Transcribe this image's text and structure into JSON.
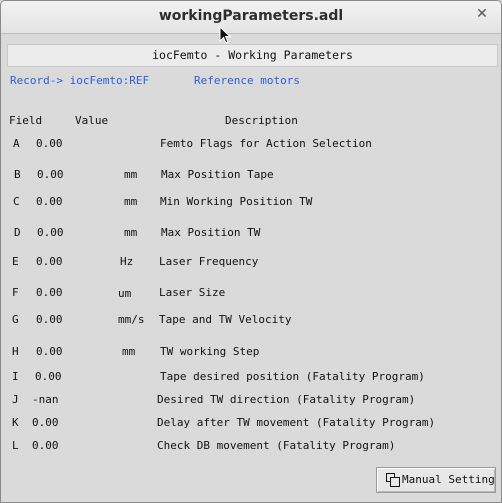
{
  "window": {
    "title": "workingParameters.adl",
    "close_glyph": "✕"
  },
  "banner": "iocFemto - Working Parameters",
  "record_link": "Record-> iocFemto:REF",
  "ref_link": "Reference motors",
  "headers": {
    "field": "Field",
    "value": "Value",
    "description": "Description"
  },
  "rows": [
    {
      "field": "A",
      "value": "0.00",
      "unit": "",
      "desc": "Femto Flags for Action Selection"
    },
    {
      "field": "B",
      "value": "0.00",
      "unit": "mm",
      "desc": "Max Position Tape"
    },
    {
      "field": "C",
      "value": "0.00",
      "unit": "mm",
      "desc": "Min Working Position TW"
    },
    {
      "field": "D",
      "value": "0.00",
      "unit": "mm",
      "desc": "Max Position TW"
    },
    {
      "field": "E",
      "value": "0.00",
      "unit": "Hz",
      "desc": "Laser Frequency"
    },
    {
      "field": "F",
      "value": "0.00",
      "unit": "um",
      "desc": "Laser Size"
    },
    {
      "field": "G",
      "value": "0.00",
      "unit": "mm/s",
      "desc": "Tape and TW Velocity"
    },
    {
      "field": "H",
      "value": "0.00",
      "unit": "mm",
      "desc": "TW working Step"
    },
    {
      "field": "I",
      "value": "0.00",
      "unit": "",
      "desc": "Tape desired position (Fatality Program)"
    },
    {
      "field": "J",
      "value": "-nan",
      "unit": "",
      "desc": "Desired TW direction (Fatality Program)"
    },
    {
      "field": "K",
      "value": "0.00",
      "unit": "",
      "desc": "Delay after TW movement (Fatality Program)"
    },
    {
      "field": "L",
      "value": "0.00",
      "unit": "",
      "desc": "Check DB movement (Fatality Program)"
    }
  ],
  "manual_button": "Manual Setting",
  "colors": {
    "link": "#2a5fd8",
    "background": "#dadada",
    "banner": "#ececec"
  }
}
